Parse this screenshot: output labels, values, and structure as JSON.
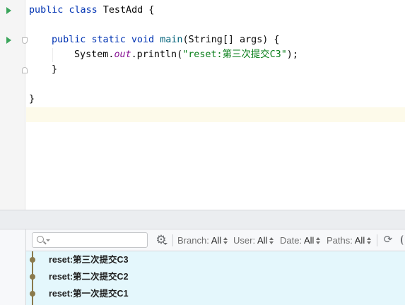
{
  "editor": {
    "lines": {
      "l1": {
        "kw1": "public",
        "kw2": "class",
        "rest": " TestAdd {"
      },
      "l3": {
        "kw1": "public",
        "kw2": "static",
        "kw3": "void",
        "fn": "main",
        "rest": "(String[] args) {"
      },
      "l4": {
        "pre": "System.",
        "field": "out",
        "mid": ".println(",
        "str": "\"reset:第三次提交C3\"",
        "post": ");"
      },
      "l5": "}",
      "l7": "}"
    }
  },
  "vcs_log": {
    "search": {
      "value": "",
      "placeholder": ""
    },
    "filters": {
      "branch": {
        "label": "Branch:",
        "value": "All"
      },
      "user": {
        "label": "User:",
        "value": "All"
      },
      "date": {
        "label": "Date:",
        "value": "All"
      },
      "paths": {
        "label": "Paths:",
        "value": "All"
      }
    },
    "commits": [
      {
        "message": "reset:第三次提交C3"
      },
      {
        "message": "reset:第二次提交C2"
      },
      {
        "message": "reset:第一次提交C1"
      }
    ]
  },
  "icons": {
    "run": "run-icon",
    "fold": "fold-icon",
    "search": "search-icon",
    "settings": "gear-icon",
    "refresh": "refresh-icon"
  },
  "colors": {
    "keyword": "#0033b3",
    "method": "#00627a",
    "static_field": "#871094",
    "string": "#067d17",
    "run_green": "#3aa55a",
    "commit_list_bg": "#e4f7fc",
    "graph": "#8a7a4c",
    "caret_row": "#fdfaea"
  }
}
